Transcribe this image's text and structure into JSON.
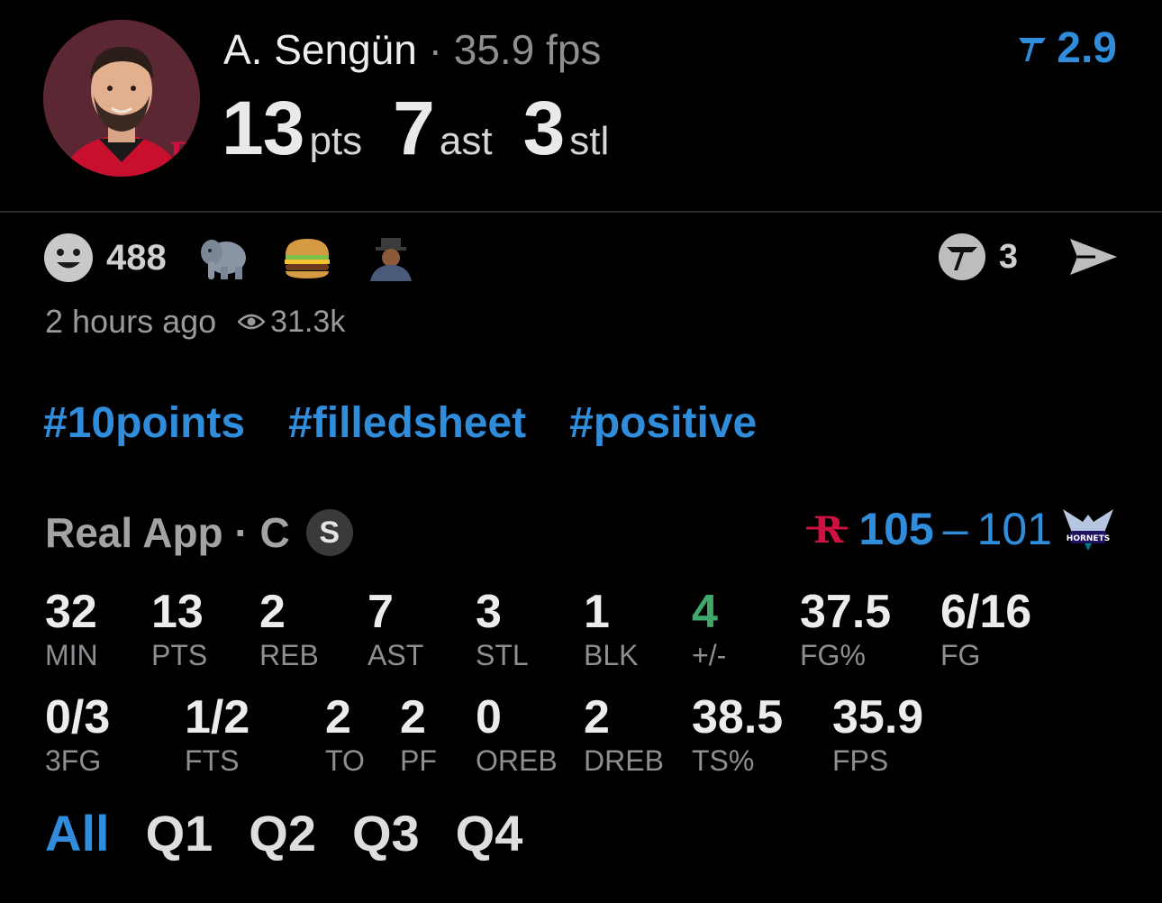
{
  "player": {
    "name": "A. Sengün",
    "separator": "·",
    "fps_text": "35.9 fps",
    "headline": [
      {
        "value": "13",
        "unit": "pts"
      },
      {
        "value": "7",
        "unit": "ast"
      },
      {
        "value": "3",
        "unit": "stl"
      }
    ]
  },
  "rating": {
    "value": "2.9",
    "icon": "real-app-logo-icon"
  },
  "reactions": {
    "count": "488",
    "items": [
      "🐘",
      "🍔",
      "custom-sticker"
    ]
  },
  "actions": {
    "count": "3"
  },
  "meta": {
    "time": "2 hours ago",
    "views": "31.3k"
  },
  "tags": [
    "#10points",
    "#filledsheet",
    "#positive"
  ],
  "game": {
    "title": "Real App · C",
    "badge": "S",
    "home_score": "105",
    "dash": "–",
    "away_score": "101",
    "colors": {
      "accent": "#2f8ddc",
      "positive": "#3fa96a",
      "rockets_red": "#ce1141",
      "hornets_teal": "#00788c"
    }
  },
  "stats_row1": [
    {
      "value": "32",
      "label": "MIN"
    },
    {
      "value": "13",
      "label": "PTS"
    },
    {
      "value": "2",
      "label": "REB"
    },
    {
      "value": "7",
      "label": "AST"
    },
    {
      "value": "3",
      "label": "STL"
    },
    {
      "value": "1",
      "label": "BLK"
    },
    {
      "value": "4",
      "label": "+/-"
    },
    {
      "value": "37.5",
      "label": "FG%"
    },
    {
      "value": "6/16",
      "label": "FG"
    }
  ],
  "stats_row2": [
    {
      "value": "0/3",
      "label": "3FG"
    },
    {
      "value": "1/2",
      "label": "FTS"
    },
    {
      "value": "2",
      "label": "TO"
    },
    {
      "value": "2",
      "label": "PF"
    },
    {
      "value": "0",
      "label": "OREB"
    },
    {
      "value": "2",
      "label": "DREB"
    },
    {
      "value": "38.5",
      "label": "TS%"
    },
    {
      "value": "35.9",
      "label": "FPS"
    }
  ],
  "quarters": [
    "All",
    "Q1",
    "Q2",
    "Q3",
    "Q4"
  ],
  "active_quarter": "All"
}
